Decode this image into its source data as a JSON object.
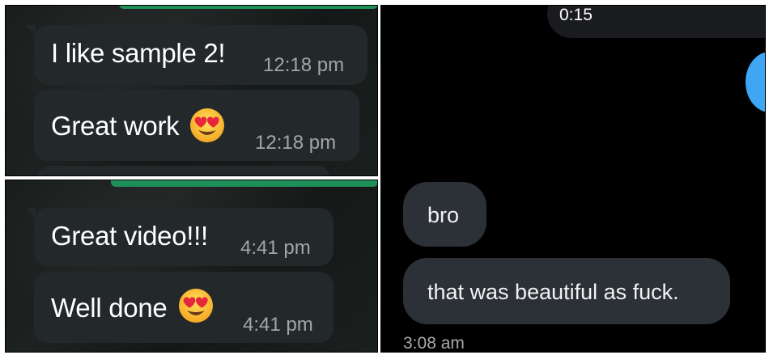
{
  "panel_top_left": {
    "messages": [
      {
        "text": "I like sample 2!",
        "time": "12:18 pm"
      },
      {
        "text": "Great work",
        "emoji": "heart-eyes",
        "time": "12:18 pm"
      }
    ]
  },
  "panel_bottom_left": {
    "messages": [
      {
        "text": "Great video!!!",
        "time": "4:41 pm"
      },
      {
        "text": "Well done",
        "emoji": "heart-eyes",
        "time": "4:41 pm"
      }
    ]
  },
  "panel_right": {
    "voice_message_duration": "0:15",
    "messages": [
      {
        "text": "bro"
      },
      {
        "text": "that was beautiful as fuck."
      }
    ],
    "time": "3:08 am",
    "colors": {
      "bubble": "#2c3037",
      "avatar_circle": "#3ea6f2",
      "background": "#000000"
    }
  },
  "colors": {
    "whatsapp_bubble": "#23282b",
    "whatsapp_accent": "#1f8f5a",
    "timestamp": "#a2a6a8"
  }
}
